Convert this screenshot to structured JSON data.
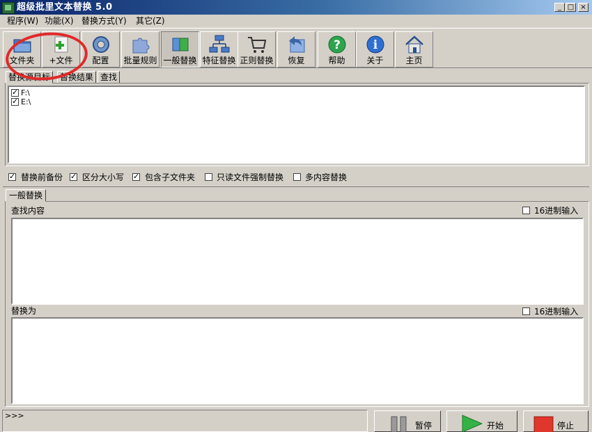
{
  "window": {
    "title": "超级批里文本替换 5.0",
    "controls": [
      "_",
      "□",
      "×"
    ]
  },
  "menu": [
    "程序(W)",
    "功能(X)",
    "替换方式(Y)",
    "其它(Z)"
  ],
  "toolbar": [
    {
      "label": "文件夹",
      "icon": "folder-icon"
    },
    {
      "label": "+文件",
      "icon": "add-file-icon"
    },
    {
      "label": "配置",
      "icon": "settings-gear-icon"
    },
    {
      "label": "批量规则",
      "icon": "puzzle-icon"
    },
    {
      "label": "一般替换",
      "icon": "replace-docs-icon",
      "pressed": true
    },
    {
      "label": "特征替换",
      "icon": "network-icon"
    },
    {
      "label": "正则替换",
      "icon": "cart-icon"
    },
    {
      "label": "恢复",
      "icon": "undo-arrow-icon"
    },
    {
      "label": "帮助",
      "icon": "help-icon"
    },
    {
      "label": "关于",
      "icon": "info-icon"
    },
    {
      "label": "主页",
      "icon": "home-icon"
    }
  ],
  "target_tabs": [
    "替换源目标",
    "替换结果",
    "查找"
  ],
  "targets": [
    {
      "label": "F:\\",
      "checked": true
    },
    {
      "label": "E:\\",
      "checked": true
    }
  ],
  "options": [
    {
      "label": "替换前备份",
      "checked": true
    },
    {
      "label": "区分大小写",
      "checked": true
    },
    {
      "label": "包含子文件夹",
      "checked": true
    },
    {
      "label": "只读文件强制替换",
      "checked": false
    },
    {
      "label": "多内容替换",
      "checked": false
    }
  ],
  "mode_tabs": [
    "一般替换"
  ],
  "find": {
    "label": "查找内容",
    "hex_label": "16进制输入",
    "hex_checked": false,
    "value": ""
  },
  "replace": {
    "label": "替换为",
    "hex_label": "16进制输入",
    "hex_checked": false,
    "value": ""
  },
  "status": {
    "text": ">>>"
  },
  "actions": [
    {
      "label": "暂停",
      "icon": "pause-icon"
    },
    {
      "label": "开始",
      "icon": "play-icon"
    },
    {
      "label": "停止",
      "icon": "stop-icon"
    }
  ],
  "colors": {
    "annotation": "#e02a2a",
    "title_start": "#0a246a",
    "title_end": "#a6caf0",
    "face": "#d4d0c8"
  }
}
